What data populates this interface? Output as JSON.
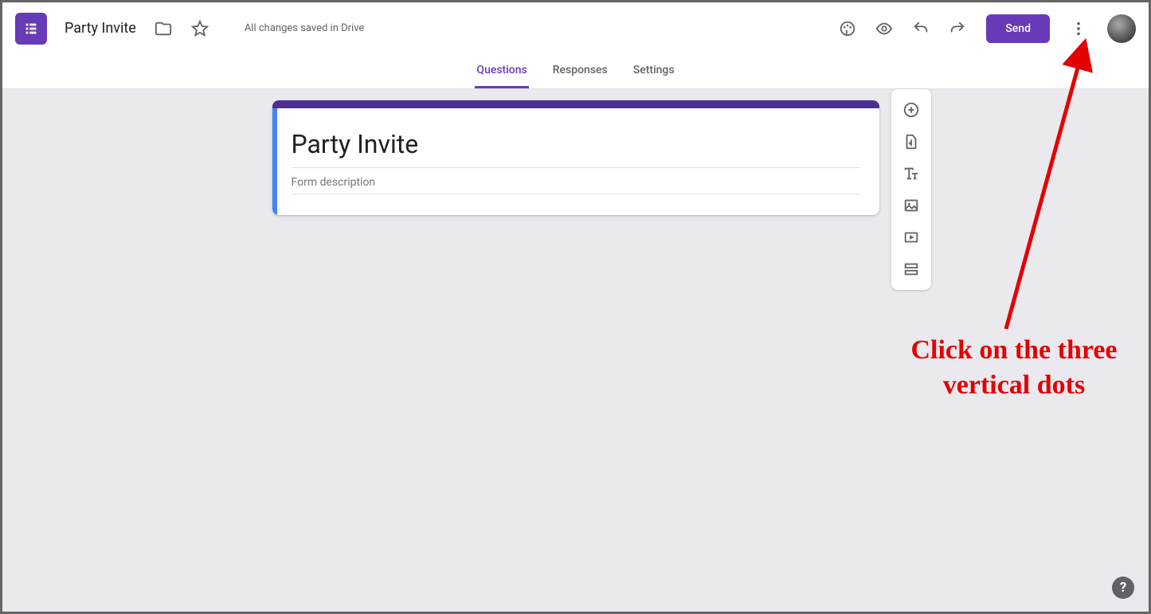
{
  "header": {
    "doc_title": "Party Invite",
    "save_status": "All changes saved in Drive",
    "send_label": "Send"
  },
  "tabs": {
    "questions": "Questions",
    "responses": "Responses",
    "settings": "Settings",
    "active": "questions"
  },
  "form": {
    "title_value": "Party Invite",
    "description_placeholder": "Form description"
  },
  "side_toolbar": {
    "add_question": "add-question",
    "import_questions": "import-questions",
    "add_title": "add-title-description",
    "add_image": "add-image",
    "add_video": "add-video",
    "add_section": "add-section"
  },
  "annotation": {
    "text": "Click on the three vertical dots"
  },
  "help_label": "?"
}
